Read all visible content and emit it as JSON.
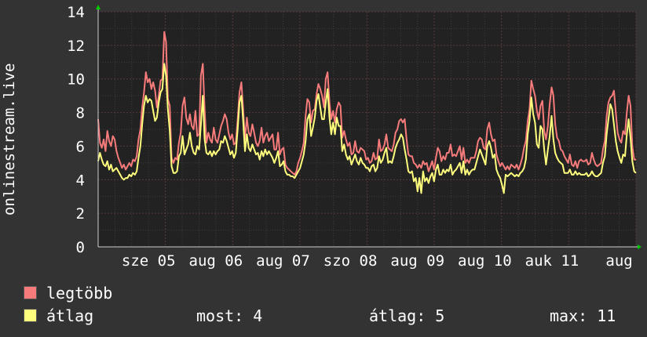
{
  "chart_data": {
    "type": "line",
    "ylabel": "onlinestream.live",
    "ylim": [
      0,
      14
    ],
    "yticks": [
      0,
      2,
      4,
      6,
      8,
      10,
      12,
      14
    ],
    "grid": true,
    "x_tick_labels": [
      "sze 05",
      "aug 06",
      "aug 07",
      "szo 08",
      "aug 09",
      "aug 10",
      "auk 11",
      "aug"
    ],
    "series": [
      {
        "name": "legtöbb",
        "color": "#f77b7b",
        "values": [
          7.6,
          6.2,
          5.9,
          6.4,
          5.7,
          6.9,
          6.3,
          6.0,
          6.6,
          6.4,
          5.7,
          5.3,
          5.0,
          4.7,
          4.9,
          4.6,
          4.8,
          5.0,
          4.8,
          5.2,
          5.1,
          5.4,
          6.4,
          7.0,
          8.3,
          9.2,
          10.4,
          9.8,
          10.0,
          9.4,
          9.8,
          9.3,
          8.3,
          9.0,
          9.9,
          10.0,
          12.8,
          12.2,
          8.8,
          8.4,
          5.3,
          5.0,
          5.3,
          5.2,
          6.2,
          6.8,
          8.4,
          8.9,
          7.7,
          7.3,
          7.9,
          7.2,
          7.0,
          8.1,
          6.6,
          6.7,
          10.2,
          10.9,
          8.2,
          6.2,
          6.8,
          6.4,
          6.2,
          7.1,
          6.4,
          6.2,
          6.7,
          7.2,
          7.5,
          7.9,
          7.6,
          6.8,
          6.4,
          6.7,
          6.1,
          6.2,
          7.6,
          9.2,
          9.8,
          8.2,
          6.4,
          7.7,
          6.8,
          6.6,
          7.3,
          6.8,
          6.2,
          6.0,
          6.3,
          7.1,
          6.2,
          6.6,
          6.8,
          6.3,
          6.5,
          6.7,
          5.8,
          5.8,
          6.8,
          5.5,
          5.8,
          5.9,
          4.9,
          4.7,
          4.6,
          4.5,
          4.4,
          4.3,
          4.5,
          5.0,
          5.3,
          5.7,
          6.2,
          7.8,
          8.8,
          8.6,
          7.4,
          8.1,
          8.2,
          9.1,
          9.7,
          9.4,
          9.0,
          8.3,
          10.0,
          10.4,
          8.6,
          7.6,
          8.1,
          7.4,
          8.2,
          8.6,
          8.4,
          6.5,
          6.9,
          6.4,
          6.0,
          6.2,
          5.5,
          5.6,
          6.3,
          5.7,
          5.6,
          5.9,
          5.8,
          5.7,
          5.2,
          5.3,
          5.0,
          5.1,
          5.6,
          5.2,
          5.3,
          6.4,
          5.7,
          5.8,
          6.1,
          6.7,
          5.9,
          5.8,
          5.7,
          6.1,
          6.8,
          7.0,
          7.5,
          7.6,
          7.4,
          7.6,
          6.4,
          5.5,
          5.4,
          5.4,
          5.0,
          4.9,
          4.7,
          4.9,
          4.7,
          5.1,
          4.9,
          5.0,
          4.5,
          4.8,
          5.1,
          4.6,
          5.3,
          5.9,
          5.7,
          5.1,
          5.4,
          5.2,
          5.6,
          5.6,
          6.1,
          5.4,
          5.5,
          5.4,
          5.7,
          6.0,
          5.2,
          5.9,
          5.0,
          5.2,
          5.0,
          5.3,
          5.3,
          5.3,
          5.7,
          6.3,
          6.5,
          6.4,
          5.9,
          5.8,
          7.0,
          7.4,
          6.7,
          6.3,
          6.4,
          5.5,
          5.1,
          4.8,
          5.0,
          4.8,
          4.6,
          4.8,
          4.6,
          4.9,
          4.8,
          4.7,
          4.9,
          4.6,
          4.9,
          5.3,
          5.9,
          6.3,
          7.5,
          8.2,
          9.9,
          9.4,
          9.0,
          8.1,
          7.6,
          8.4,
          8.7,
          6.9,
          6.4,
          7.2,
          8.5,
          9.5,
          9.0,
          7.3,
          6.5,
          6.3,
          5.8,
          5.7,
          5.4,
          5.2,
          5.0,
          5.5,
          4.9,
          4.8,
          5.1,
          4.7,
          5.1,
          5.2,
          5.1,
          5.1,
          5.2,
          4.9,
          5.0,
          5.6,
          5.2,
          4.9,
          4.8,
          4.9,
          5.0,
          5.8,
          6.3,
          7.8,
          8.6,
          8.9,
          9.0,
          9.3,
          8.0,
          6.8,
          6.4,
          6.2,
          6.9,
          6.7,
          8.0,
          9.0,
          8.4,
          6.0,
          5.2,
          5.2
        ]
      },
      {
        "name": "átlag",
        "color": "#ffff7d",
        "values": [
          5.1,
          5.6,
          5.2,
          4.9,
          4.8,
          5.1,
          4.6,
          4.9,
          4.5,
          4.6,
          4.7,
          4.5,
          4.3,
          4.1,
          4.0,
          4.1,
          4.1,
          4.3,
          4.2,
          4.4,
          4.3,
          4.5,
          5.3,
          6.0,
          7.3,
          8.4,
          9.0,
          8.6,
          8.8,
          8.7,
          8.1,
          7.5,
          7.7,
          8.6,
          9.2,
          9.4,
          10.9,
          10.2,
          8.2,
          6.9,
          4.8,
          4.4,
          4.4,
          4.5,
          5.4,
          5.6,
          6.6,
          5.5,
          5.8,
          6.1,
          6.8,
          6.0,
          5.6,
          5.5,
          6.0,
          5.8,
          7.3,
          9.0,
          6.4,
          5.6,
          5.5,
          5.7,
          5.4,
          5.7,
          5.5,
          5.7,
          5.8,
          6.3,
          6.2,
          6.6,
          6.3,
          5.9,
          5.5,
          5.7,
          5.3,
          5.6,
          7.0,
          8.6,
          9.0,
          7.5,
          5.7,
          6.7,
          5.9,
          5.7,
          6.1,
          5.8,
          5.5,
          5.6,
          5.2,
          5.7,
          5.4,
          5.8,
          5.5,
          5.7,
          5.5,
          5.3,
          5.0,
          5.3,
          5.7,
          4.8,
          4.9,
          5.1,
          4.5,
          4.3,
          4.3,
          4.2,
          4.2,
          4.1,
          4.3,
          4.5,
          4.7,
          5.1,
          5.5,
          6.3,
          7.6,
          7.9,
          6.6,
          7.1,
          7.7,
          8.7,
          9.1,
          8.3,
          7.6,
          7.6,
          8.6,
          9.4,
          7.7,
          6.7,
          7.4,
          6.7,
          7.7,
          7.2,
          7.2,
          5.7,
          6.1,
          5.5,
          5.2,
          5.4,
          4.9,
          5.2,
          5.5,
          5.1,
          4.9,
          5.3,
          5.0,
          4.9,
          4.7,
          4.7,
          4.5,
          4.8,
          4.9,
          4.5,
          4.7,
          5.4,
          5.0,
          5.2,
          5.6,
          5.9,
          5.0,
          5.1,
          5.0,
          5.4,
          5.9,
          6.2,
          6.4,
          6.7,
          6.5,
          5.8,
          5.2,
          4.5,
          4.4,
          4.5,
          3.9,
          4.1,
          3.3,
          4.1,
          3.2,
          4.5,
          3.9,
          4.1,
          3.8,
          4.2,
          4.4,
          3.9,
          4.6,
          4.9,
          4.3,
          4.3,
          4.6,
          4.4,
          4.6,
          4.5,
          4.9,
          4.3,
          4.5,
          4.6,
          4.8,
          5.0,
          4.4,
          5.1,
          4.3,
          4.6,
          4.3,
          4.5,
          4.6,
          4.6,
          5.0,
          5.4,
          5.8,
          5.5,
          5.2,
          4.9,
          6.0,
          6.3,
          5.9,
          5.3,
          5.5,
          4.6,
          4.3,
          4.1,
          3.7,
          3.2,
          4.3,
          4.2,
          4.3,
          4.4,
          4.3,
          4.2,
          4.3,
          4.2,
          4.4,
          4.5,
          4.7,
          5.2,
          6.7,
          7.5,
          8.9,
          7.9,
          7.4,
          6.1,
          5.9,
          7.2,
          7.0,
          5.8,
          4.9,
          5.8,
          6.6,
          7.8,
          6.4,
          5.6,
          5.3,
          5.1,
          5.0,
          4.9,
          4.4,
          4.4,
          4.4,
          4.6,
          4.3,
          4.3,
          4.5,
          4.3,
          4.4,
          4.3,
          4.3,
          4.3,
          4.4,
          4.2,
          4.3,
          4.5,
          4.3,
          4.2,
          4.2,
          4.3,
          4.4,
          5.0,
          5.4,
          6.7,
          7.6,
          8.5,
          8.2,
          7.3,
          6.3,
          5.7,
          5.3,
          5.0,
          5.5,
          5.4,
          6.7,
          7.6,
          6.5,
          5.1,
          4.5,
          4.4
        ]
      }
    ]
  },
  "legend": [
    {
      "label": "legtöbb",
      "color": "#f77b7b"
    },
    {
      "label": "átlag",
      "color": "#ffff7d"
    }
  ],
  "stats": {
    "most": "most: 4",
    "atlag": "átlag: 5",
    "max": "max: 11"
  },
  "colors": {
    "background": "#333333",
    "plot_background": "#222222",
    "grid_major": "#5a3a3a",
    "grid_minor": "#3d3d3d",
    "axis": "#cfcfcf",
    "arrow": "#00cc00"
  }
}
